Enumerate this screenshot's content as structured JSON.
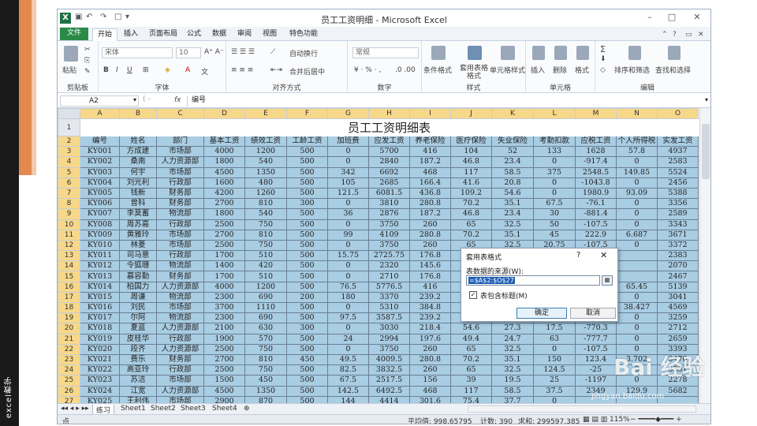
{
  "side_label": "excel教学",
  "window": {
    "title": "员工工资明细 - Microsoft Excel",
    "app_icon": "X",
    "controls": [
      "–",
      "□",
      "✕"
    ]
  },
  "ribbon_tabs": [
    "文件",
    "开始",
    "插入",
    "页面布局",
    "公式",
    "数据",
    "审阅",
    "视图",
    "特色功能"
  ],
  "ribbon": {
    "clipboard": {
      "paste": "粘贴",
      "label": "剪贴板"
    },
    "font": {
      "name": "宋体",
      "size": "10",
      "label": "字体"
    },
    "alignment": {
      "wrap": "自动换行",
      "merge": "合并后居中",
      "label": "对齐方式"
    },
    "number": {
      "format": "常规",
      "label": "数字"
    },
    "styles": {
      "cond": "条件格式",
      "table": "套用表格格式",
      "cell": "单元格样式",
      "label": "样式"
    },
    "cells": {
      "insert": "插入",
      "delete": "删除",
      "format": "格式",
      "label": "单元格"
    },
    "editing": {
      "sort": "排序和筛选",
      "find": "查找和选择",
      "label": "编辑"
    }
  },
  "formula_bar": {
    "name_box": "A2",
    "fx": "fx",
    "value": "编号"
  },
  "columns": [
    "A",
    "B",
    "C",
    "D",
    "E",
    "F",
    "G",
    "H",
    "I",
    "J",
    "K",
    "L",
    "M",
    "N",
    "O"
  ],
  "sheet_title": "员工工资明细表",
  "headers": [
    "编号",
    "姓名",
    "部门",
    "基本工资",
    "绩效工资",
    "工龄工资",
    "加班费",
    "应发工资",
    "养老保险",
    "医疗保险",
    "失业保险",
    "考勤扣款",
    "应税工资",
    "个人所得税",
    "实发工资"
  ],
  "rows": [
    [
      "KY001",
      "方成建",
      "市场部",
      "4000",
      "1200",
      "500",
      "0",
      "5700",
      "416",
      "104",
      "52",
      "133",
      "1628",
      "57.8",
      "4937"
    ],
    [
      "KY002",
      "桑南",
      "人力资源部",
      "1800",
      "540",
      "500",
      "0",
      "2840",
      "187.2",
      "46.8",
      "23.4",
      "0",
      "-917.4",
      "0",
      "2583"
    ],
    [
      "KY003",
      "何宇",
      "市场部",
      "4500",
      "1350",
      "500",
      "342",
      "6692",
      "468",
      "117",
      "58.5",
      "375",
      "2548.5",
      "149.85",
      "5524"
    ],
    [
      "KY004",
      "刘光利",
      "行政部",
      "1600",
      "480",
      "500",
      "105",
      "2685",
      "166.4",
      "41.6",
      "20.8",
      "0",
      "-1043.8",
      "0",
      "2456"
    ],
    [
      "KY005",
      "钱新",
      "财务部",
      "4200",
      "1260",
      "500",
      "121.5",
      "6081.5",
      "436.8",
      "109.2",
      "54.6",
      "0",
      "1980.9",
      "93.09",
      "5388"
    ],
    [
      "KY006",
      "曾科",
      "财务部",
      "2700",
      "810",
      "300",
      "0",
      "3810",
      "280.8",
      "70.2",
      "35.1",
      "67.5",
      "-76.1",
      "0",
      "3356"
    ],
    [
      "KY007",
      "李莫蓄",
      "物流部",
      "1800",
      "540",
      "500",
      "36",
      "2876",
      "187.2",
      "46.8",
      "23.4",
      "30",
      "-881.4",
      "0",
      "2589"
    ],
    [
      "KY008",
      "周苏嘉",
      "行政部",
      "2500",
      "750",
      "500",
      "0",
      "3750",
      "260",
      "65",
      "32.5",
      "50",
      "-107.5",
      "0",
      "3343"
    ],
    [
      "KY009",
      "黄雅玲",
      "市场部",
      "2700",
      "810",
      "500",
      "99",
      "4109",
      "280.8",
      "70.2",
      "35.1",
      "45",
      "222.9",
      "6.687",
      "3671"
    ],
    [
      "KY010",
      "林菱",
      "市场部",
      "2500",
      "750",
      "500",
      "0",
      "3750",
      "260",
      "65",
      "32.5",
      "20.75",
      "-107.5",
      "0",
      "3372"
    ],
    [
      "KY011",
      "司马意",
      "行政部",
      "1700",
      "510",
      "500",
      "15.75",
      "2725.75",
      "176.8",
      "",
      "",
      "",
      "",
      "",
      "2383"
    ],
    [
      "KY012",
      "令狐珊",
      "物流部",
      "1400",
      "420",
      "500",
      "0",
      "2320",
      "145.6",
      "",
      "",
      "",
      "",
      "",
      "2070"
    ],
    [
      "KY013",
      "慕容勤",
      "财务部",
      "1700",
      "510",
      "500",
      "0",
      "2710",
      "176.8",
      "",
      "",
      "",
      "",
      "",
      "2467"
    ],
    [
      "KY014",
      "柏国力",
      "人力资源部",
      "4000",
      "1200",
      "500",
      "76.5",
      "5776.5",
      "416",
      "",
      "",
      "",
      "",
      "65.45",
      "5139"
    ],
    [
      "KY015",
      "周谦",
      "物流部",
      "2300",
      "690",
      "200",
      "180",
      "3370",
      "239.2",
      "",
      "",
      "",
      "",
      "0",
      "3041"
    ],
    [
      "KY016",
      "刘民",
      "市场部",
      "3700",
      "1110",
      "500",
      "0",
      "5310",
      "384.8",
      "",
      "",
      "",
      "",
      "38.427",
      "4569"
    ],
    [
      "KY017",
      "尔阿",
      "物流部",
      "2300",
      "690",
      "500",
      "97.5",
      "3587.5",
      "239.2",
      "",
      "",
      "",
      "",
      "0",
      "3259"
    ],
    [
      "KY018",
      "夏蓝",
      "人力资源部",
      "2100",
      "630",
      "300",
      "0",
      "3030",
      "218.4",
      "54.6",
      "27.3",
      "17.5",
      "-770.3",
      "0",
      "2712"
    ],
    [
      "KY019",
      "皮桂华",
      "行政部",
      "1900",
      "570",
      "500",
      "24",
      "2994",
      "197.6",
      "49.4",
      "24.7",
      "63",
      "-777.7",
      "0",
      "2659"
    ],
    [
      "KY020",
      "段齐",
      "人力资源部",
      "2500",
      "750",
      "500",
      "0",
      "3750",
      "260",
      "65",
      "32.5",
      "0",
      "-107.5",
      "0",
      "3393"
    ],
    [
      "KY021",
      "费乐",
      "财务部",
      "2700",
      "810",
      "450",
      "49.5",
      "4009.5",
      "280.8",
      "70.2",
      "35.1",
      "150",
      "123.4",
      "3.702",
      "3470"
    ],
    [
      "KY022",
      "高亚玲",
      "行政部",
      "2500",
      "750",
      "500",
      "82.5",
      "3832.5",
      "260",
      "65",
      "32.5",
      "124.5",
      "-25",
      "0",
      "3351"
    ],
    [
      "KY023",
      "苏洁",
      "市场部",
      "1500",
      "450",
      "500",
      "67.5",
      "2517.5",
      "156",
      "39",
      "19.5",
      "25",
      "-1197",
      "0",
      "2278"
    ],
    [
      "KY024",
      "江宽",
      "人力资源部",
      "4500",
      "1350",
      "500",
      "142.5",
      "6492.5",
      "468",
      "117",
      "58.5",
      "37.5",
      "2349",
      "129.9",
      "5682"
    ],
    [
      "KY025",
      "王利伟",
      "市场部",
      "2900",
      "870",
      "500",
      "144",
      "4414",
      "301.6",
      "75.4",
      "37.7",
      "0",
      "",
      "",
      ""
    ]
  ],
  "dialog": {
    "title": "套用表格式",
    "help": "?",
    "close": "✕",
    "prompt": "表数据的来源(W):",
    "range": "=$A$2:$O$27",
    "checkbox_label": "表包含标题(M)",
    "checked": true,
    "ok": "确定",
    "cancel": "取消"
  },
  "sheet_tabs": [
    "练习",
    "Sheet1",
    "Sheet2",
    "Sheet3",
    "Sheet4"
  ],
  "status": {
    "mode": "点",
    "average": "平均值: 998.65795",
    "count": "计数: 390",
    "sum": "求和: 299597.385",
    "zoom": "115%"
  },
  "watermark": {
    "text": "Bai 经验",
    "sub": "jingyan.baidu.com"
  }
}
